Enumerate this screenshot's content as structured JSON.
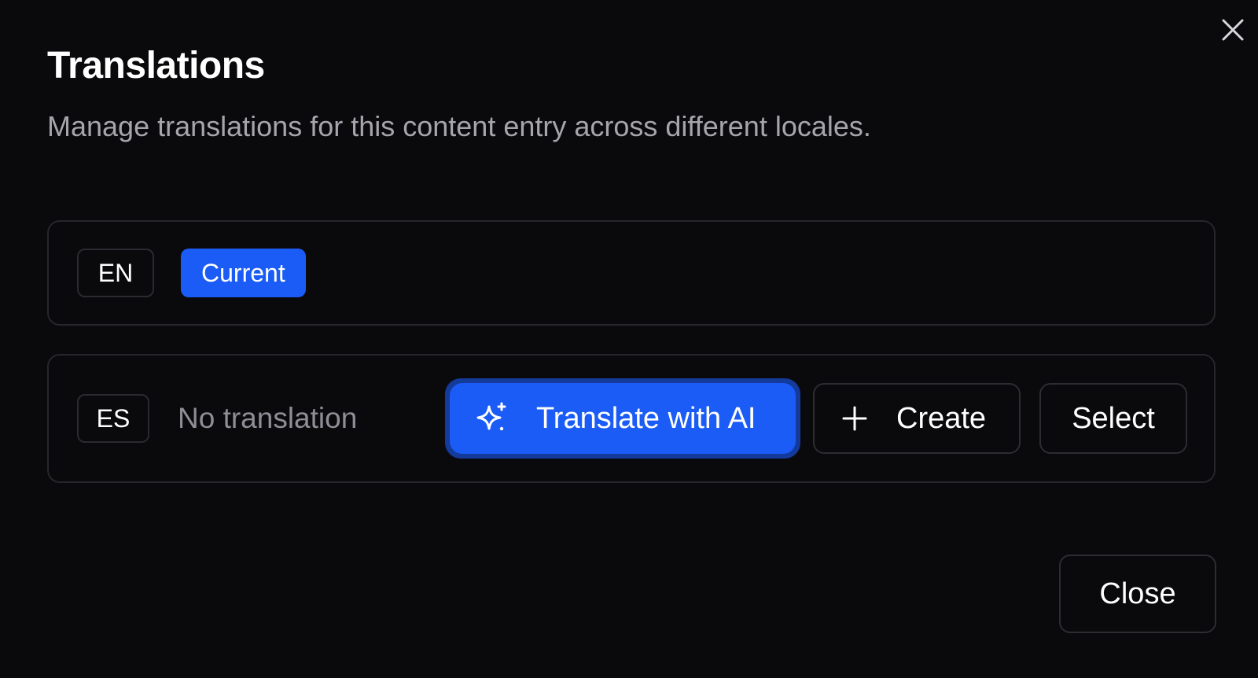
{
  "dialog": {
    "title": "Translations",
    "description": "Manage translations for this content entry across different locales."
  },
  "locales": [
    {
      "code": "EN",
      "status_badge": "Current"
    },
    {
      "code": "ES",
      "status_text": "No translation"
    }
  ],
  "actions": {
    "translate_ai_label": "Translate with AI",
    "create_label": "Create",
    "select_label": "Select"
  },
  "footer": {
    "close_label": "Close"
  },
  "icons": {
    "close": "close-icon",
    "sparkles": "sparkles-icon",
    "plus": "plus-icon"
  },
  "colors": {
    "background": "#0a0a0c",
    "accent": "#1a5cf5",
    "border": "#26262b",
    "muted_text": "#8e8e95"
  }
}
